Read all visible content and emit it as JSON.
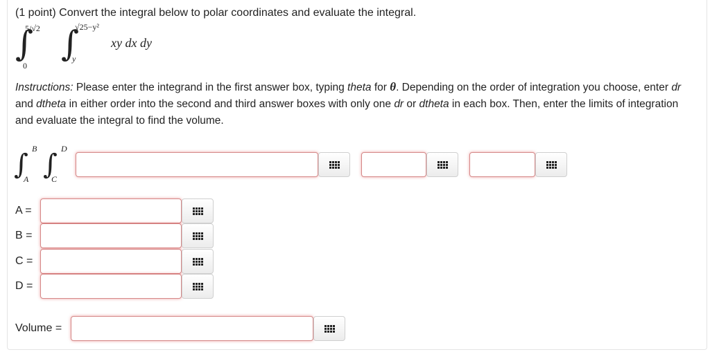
{
  "problem": {
    "points": "(1 point)",
    "statement": "Convert the integral below to polar coordinates and evaluate the integral."
  },
  "given_integral": {
    "outer_lower": "0",
    "outer_upper": "5/√2",
    "inner_lower": "y",
    "inner_upper": "√25−y²",
    "integrand": "xy dx dy"
  },
  "instructions": {
    "label": "Instructions:",
    "text_1": " Please enter the integrand in the first answer box, typing ",
    "theta_word": "theta",
    "text_2": " for ",
    "theta_symbol": "θ",
    "text_3": ". Depending on the order of integration you choose, enter ",
    "dr_1": "dr",
    "text_4": " and ",
    "dtheta_1": "dtheta",
    "text_5": " in either order into the second and third answer boxes with only one ",
    "dr_2": "dr",
    "text_6": " or ",
    "dtheta_2": "dtheta",
    "text_7": " in each box. Then, enter the limits of integration and evaluate the integral to find the volume."
  },
  "polar_integral": {
    "outer_lower": "A",
    "outer_upper": "B",
    "inner_lower": "C",
    "inner_upper": "D"
  },
  "answer_fields": {
    "integrand": "",
    "differential_1": "",
    "differential_2": "",
    "A": "",
    "B": "",
    "C": "",
    "D": "",
    "volume": ""
  },
  "labels": {
    "A": "A =",
    "B": "B =",
    "C": "C =",
    "D": "D =",
    "volume": "Volume ="
  },
  "icons": {
    "equation_editor": "grid-icon"
  },
  "colors": {
    "input_border": "#d58888",
    "input_glow": "#dc4646"
  }
}
